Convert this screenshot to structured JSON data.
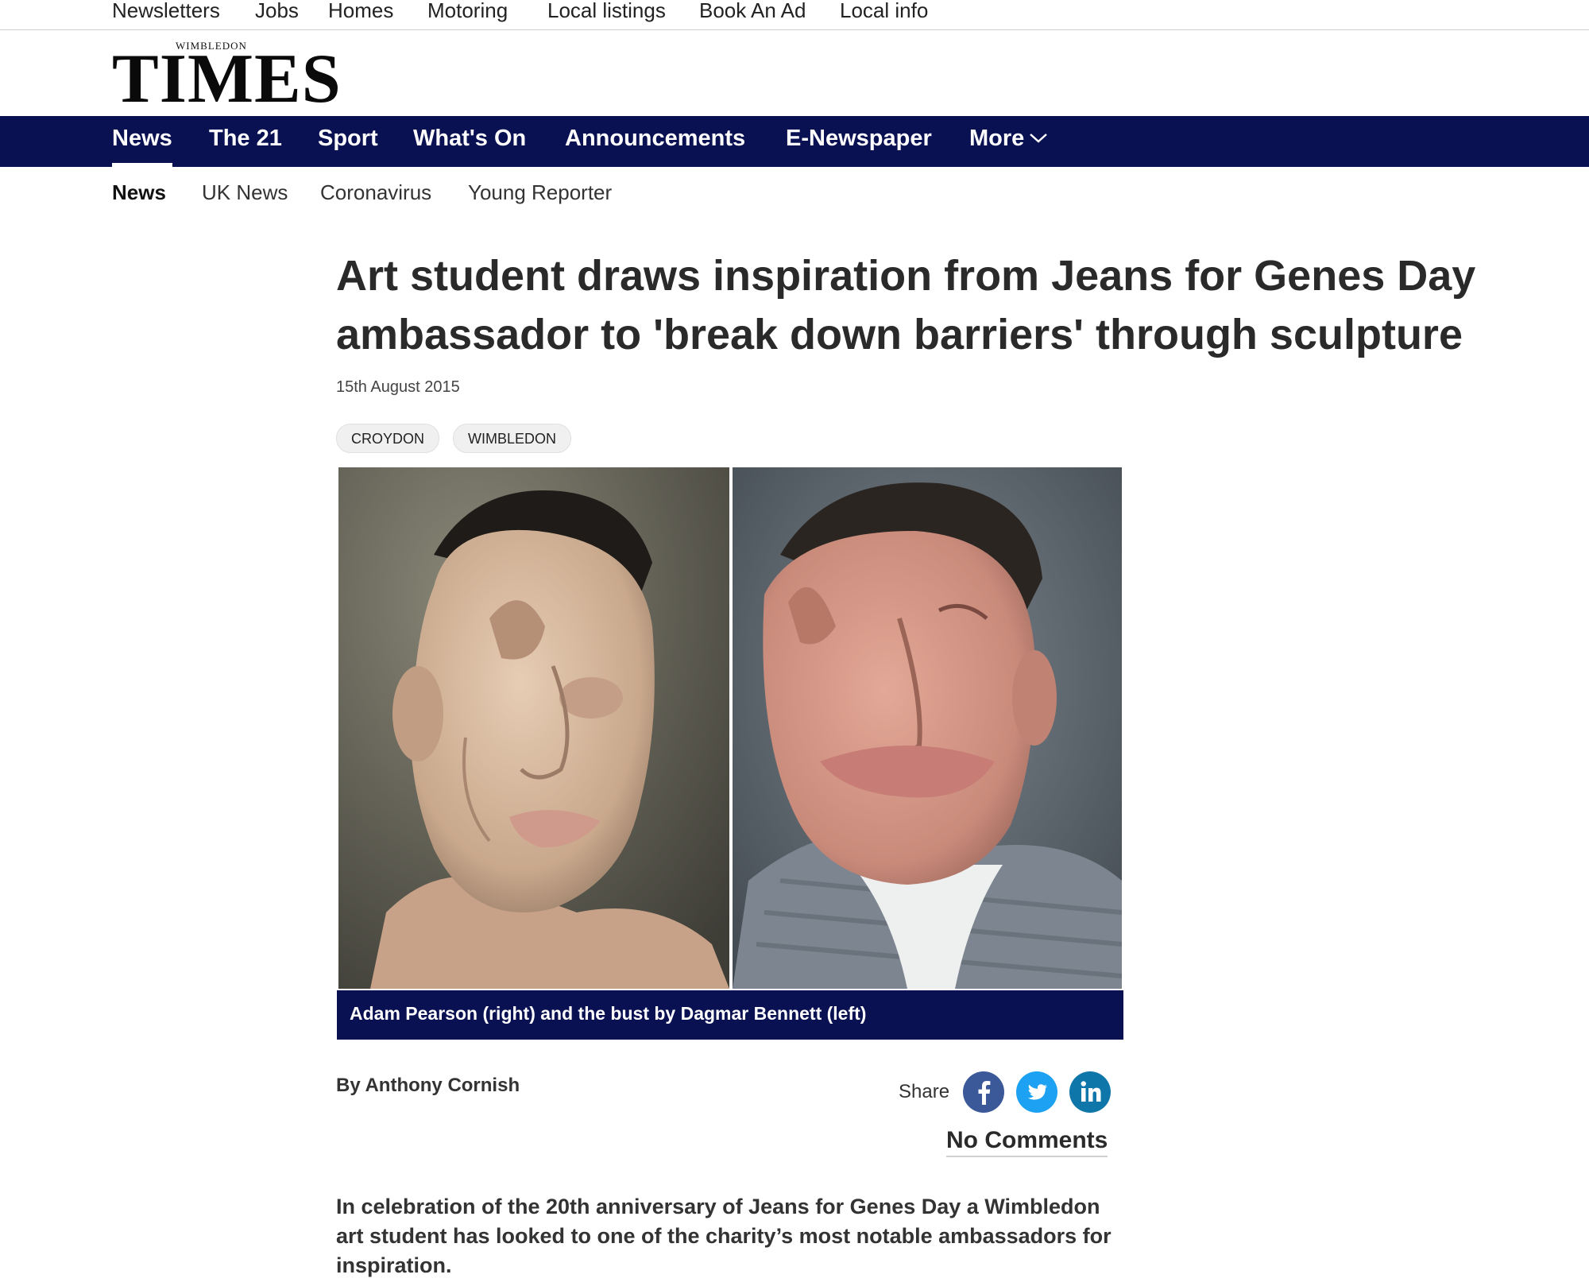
{
  "utility_nav": [
    "Newsletters",
    "Jobs",
    "Homes",
    "Motoring",
    "Local listings",
    "Book An Ad",
    "Local info"
  ],
  "masthead": {
    "superscript": "WIMBLEDON",
    "title": "TIMES"
  },
  "primary_nav": {
    "items": [
      "News",
      "The 21",
      "Sport",
      "What's On",
      "Announcements",
      "E-Newspaper",
      "More"
    ],
    "active": "News"
  },
  "secondary_nav": {
    "items": [
      "News",
      "UK News",
      "Coronavirus",
      "Young Reporter"
    ],
    "active": "News"
  },
  "article": {
    "headline": "Art student draws inspiration from Jeans for Genes Day ambassador to 'break down barriers' through sculpture",
    "date": "15th August 2015",
    "tags": [
      "CROYDON",
      "WIMBLEDON"
    ],
    "caption": "Adam Pearson (right) and the bust by Dagmar Bennett (left)",
    "byline": "By Anthony Cornish",
    "share_label": "Share",
    "share_icons": [
      "facebook-icon",
      "twitter-icon",
      "linkedin-icon"
    ],
    "comments": "No Comments",
    "intro": "In celebration of the 20th anniversary of Jeans for Genes Day a Wimbledon art student has looked to one of the charity’s most notable ambassadors for inspiration."
  },
  "colors": {
    "nav_background": "#0a1152",
    "facebook": "#3b5998",
    "twitter": "#1da1f2",
    "linkedin": "#0e76a8"
  }
}
